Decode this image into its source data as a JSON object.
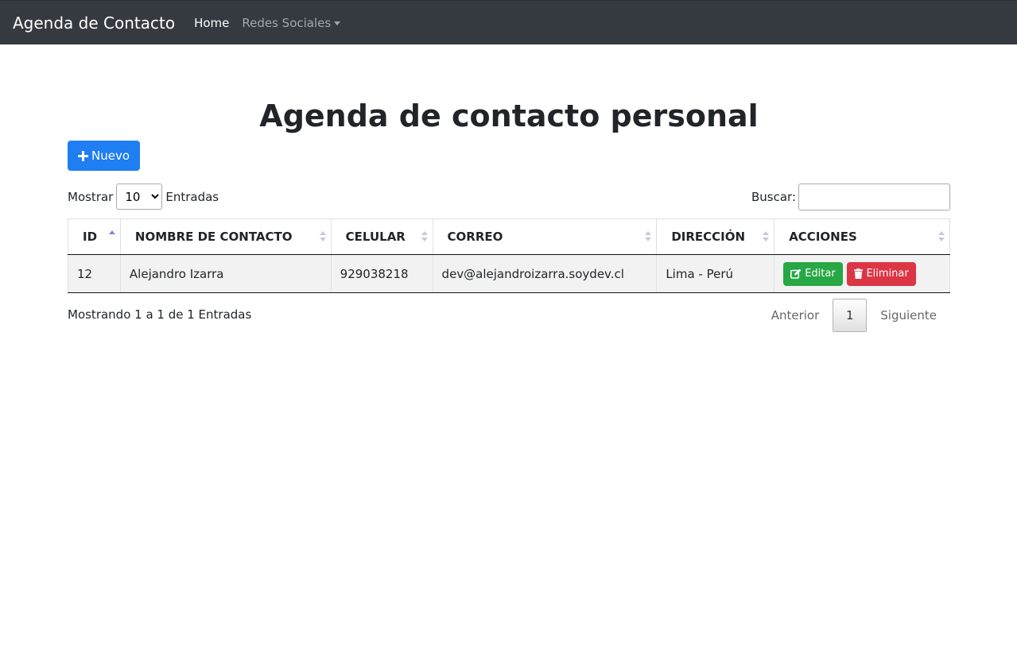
{
  "navbar": {
    "brand": "Agenda de Contacto",
    "links": [
      {
        "label": "Home"
      },
      {
        "label": "Redes Sociales"
      }
    ]
  },
  "main": {
    "title": "Agenda de contacto personal",
    "new_button": "Nuevo",
    "length": {
      "prefix": "Mostrar",
      "selected": "10",
      "suffix": "Entradas"
    },
    "search": {
      "label": "Buscar:",
      "value": ""
    },
    "table": {
      "columns": [
        "ID",
        "NOMBRE DE CONTACTO",
        "CELULAR",
        "CORREO",
        "DIRECCIÓN",
        "ACCIONES"
      ],
      "rows": [
        {
          "id": "12",
          "name": "Alejandro Izarra",
          "phone": "929038218",
          "email": "dev@alejandroizarra.soydev.cl",
          "address": "Lima - Perú"
        }
      ],
      "actions": {
        "edit": "Editar",
        "delete": "Eliminar"
      }
    },
    "info": "Mostrando 1 a 1 de 1 Entradas",
    "pagination": {
      "prev": "Anterior",
      "current": "1",
      "next": "Siguiente"
    }
  },
  "colors": {
    "navbar": "#343a40",
    "primary": "#1e7ef2",
    "success": "#28a745",
    "danger": "#dc3545"
  }
}
